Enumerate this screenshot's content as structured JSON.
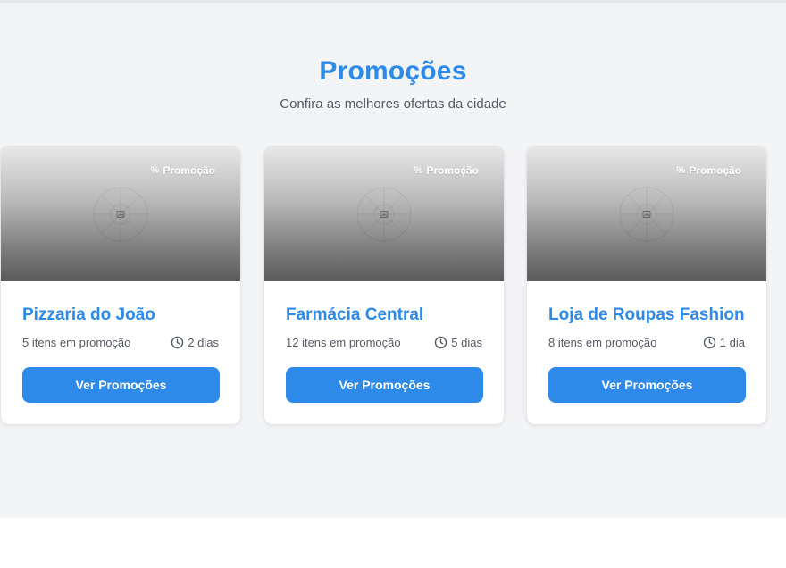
{
  "section": {
    "title": "Promoções",
    "subtitle": "Confira as melhores ofertas da cidade"
  },
  "cards": [
    {
      "badge_icon": "percent-icon",
      "badge_label": "Promoção",
      "image_icon": "image-placeholder-icon",
      "name": "Pizzaria do João",
      "items": "5 itens em promoção",
      "days": "2 dias",
      "button": "Ver Promoções"
    },
    {
      "badge_icon": "percent-icon",
      "badge_label": "Promoção",
      "image_icon": "image-placeholder-icon",
      "name": "Farmácia Central",
      "items": "12 itens em promoção",
      "days": "5 dias",
      "button": "Ver Promoções"
    },
    {
      "badge_icon": "percent-icon",
      "badge_label": "Promoção",
      "image_icon": "image-placeholder-icon",
      "name": "Loja de Roupas Fashion",
      "items": "8 itens em promoção",
      "days": "1 dia",
      "button": "Ver Promoções"
    }
  ],
  "colors": {
    "accent": "#2d8ae8",
    "background": "#f3f4f6",
    "card": "#ffffff",
    "muted_text": "#555b64"
  }
}
